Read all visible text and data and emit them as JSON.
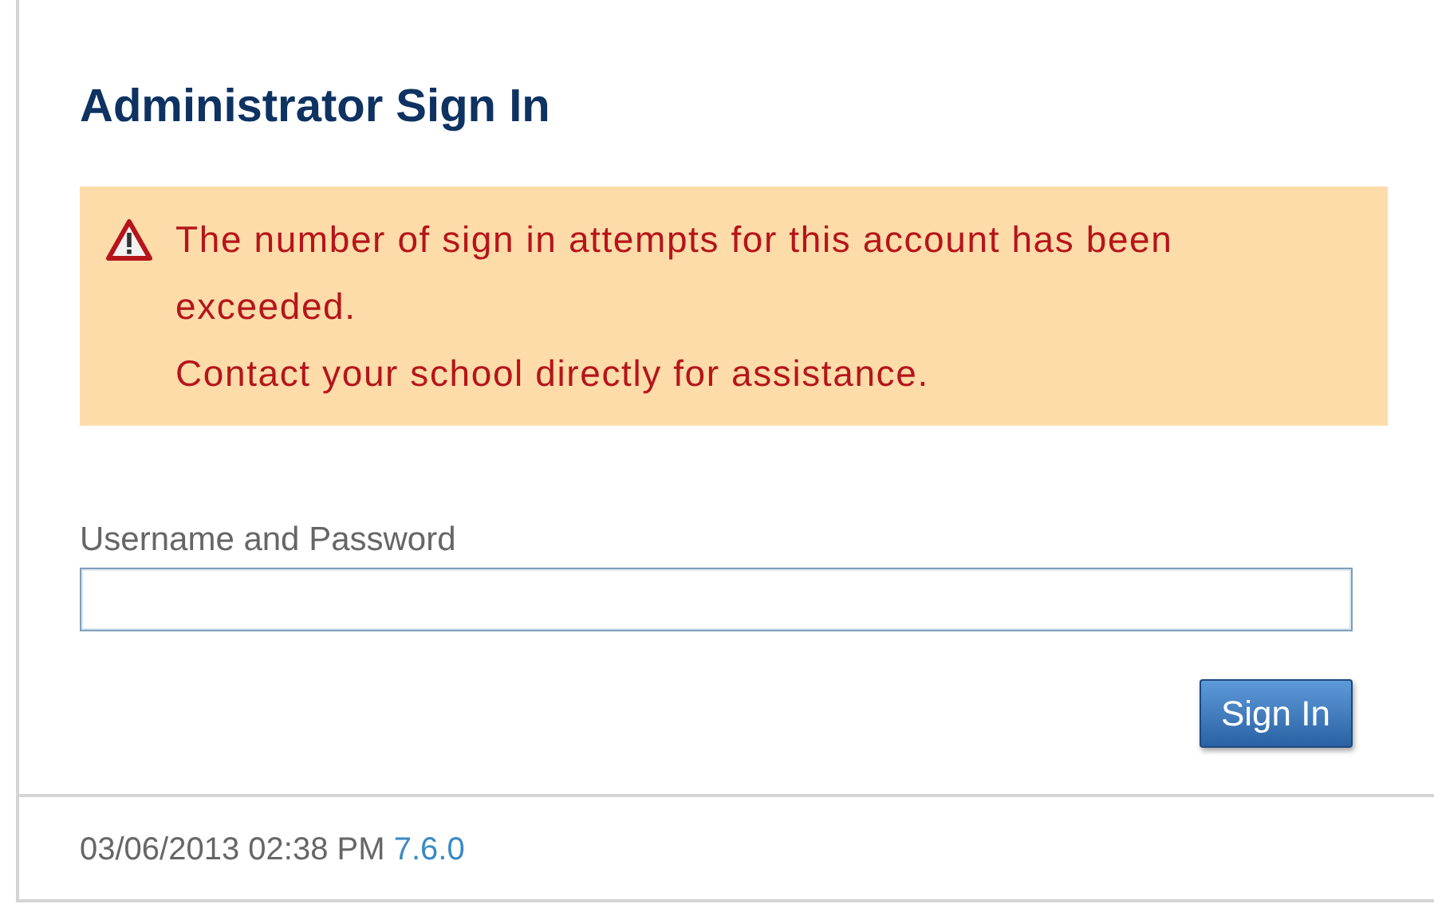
{
  "title": "Administrator Sign In",
  "alert": {
    "lines": [
      "The number of sign in attempts for this account has been exceeded.",
      "Contact your school directly for assistance."
    ]
  },
  "field": {
    "label": "Username and Password"
  },
  "button": "Sign In",
  "footer": {
    "timestamp": "03/06/2013 02:38 PM",
    "version": "7.6.0"
  }
}
